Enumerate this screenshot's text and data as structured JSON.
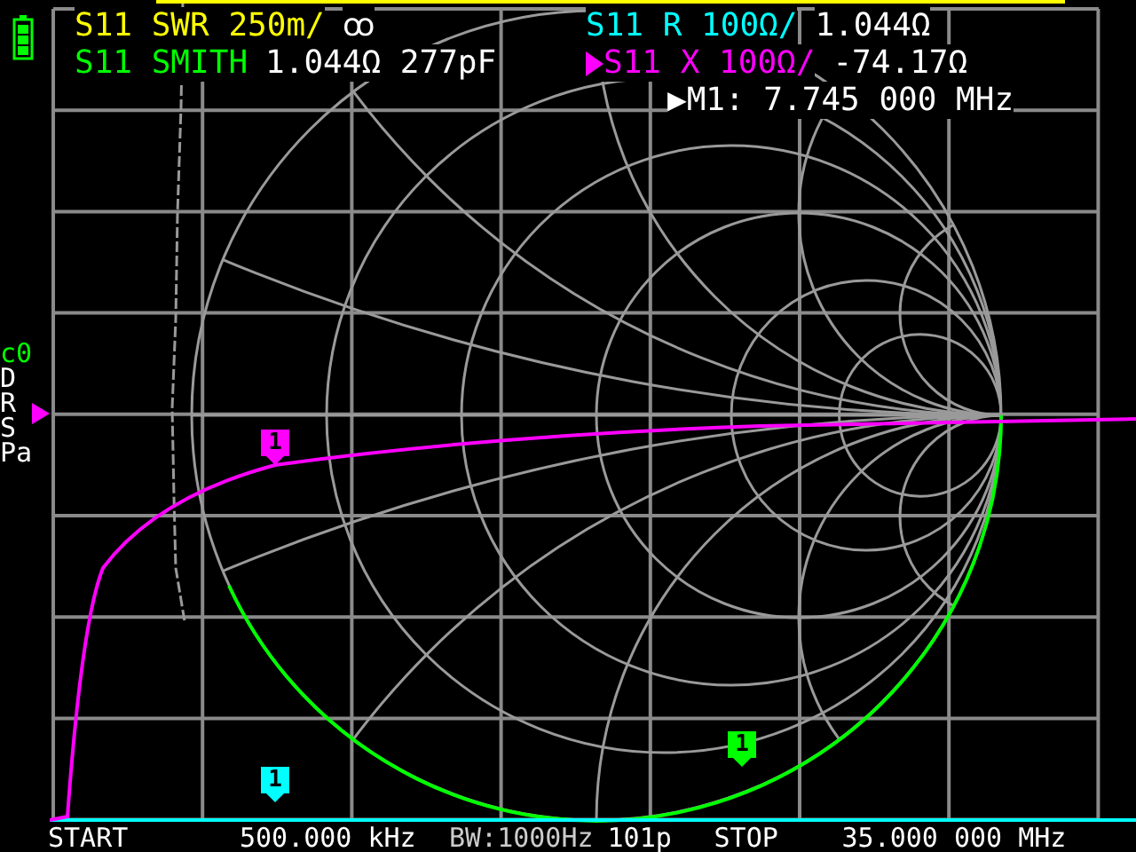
{
  "left_traces": [
    {
      "label": "S11 SWR 250m/",
      "value": "ꝏ",
      "color": "#ffff00",
      "selected": false
    },
    {
      "label": "S11 SMITH",
      "value": "1.044Ω 277pF",
      "color": "#00ff00",
      "selected": false
    }
  ],
  "right_traces": [
    {
      "label": "S11 R 100Ω/",
      "value": "1.044Ω",
      "color": "#00ffff",
      "selected": false
    },
    {
      "label": "S11 X 100Ω/",
      "value": "-74.17Ω",
      "color": "#ff00ff",
      "selected": true
    }
  ],
  "marker_readout": "▶M1: 7.745 000 MHz",
  "left_labels": [
    {
      "text": "c0",
      "color": "#00ff00"
    },
    {
      "text": "D",
      "color": "#ffffff"
    },
    {
      "text": "R",
      "color": "#ffffff"
    },
    {
      "text": "S",
      "color": "#ffffff"
    },
    {
      "text": "Pa",
      "color": "#ffffff"
    }
  ],
  "markers": [
    {
      "label": "1",
      "color": "#ff00ff"
    },
    {
      "label": "1",
      "color": "#00ffff"
    },
    {
      "label": "1",
      "color": "#00ff00"
    }
  ],
  "footer": {
    "start_label": "START",
    "start": "500.000 kHz",
    "bw": "BW:1000Hz",
    "points": "101p",
    "stop_label": "STOP",
    "stop": "35.000 000 MHz"
  }
}
